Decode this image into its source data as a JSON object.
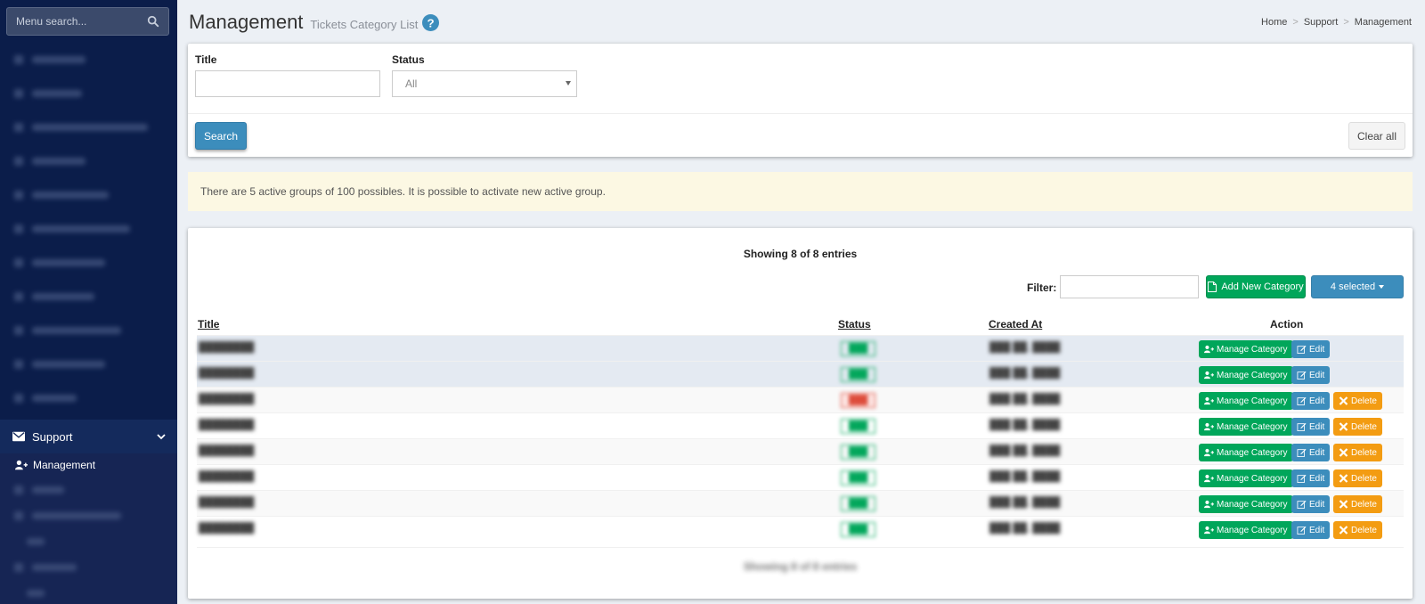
{
  "sidebar": {
    "search_placeholder": "Menu search...",
    "active_section": "Support",
    "active_item": "Management"
  },
  "header": {
    "title": "Management",
    "subtitle": "Tickets Category List",
    "breadcrumb": [
      "Home",
      "Support",
      "Management"
    ]
  },
  "filters": {
    "title_label": "Title",
    "title_value": "",
    "status_label": "Status",
    "status_value": "All",
    "search_button": "Search",
    "clear_button": "Clear all"
  },
  "alert": {
    "text": "There are 5 active groups of 100 possibles. It is possible to activate new active group."
  },
  "table": {
    "showing": "Showing 8 of 8 entries",
    "filter_label": "Filter:",
    "add_button": "Add New Category",
    "selected_button": "4 selected",
    "columns": [
      "Title",
      "Status",
      "Created At",
      "Action"
    ],
    "actions": {
      "manage": "Manage Category",
      "edit": "Edit",
      "delete": "Delete"
    },
    "rows": [
      {
        "selected": true,
        "status": "active",
        "deletable": false
      },
      {
        "selected": true,
        "status": "active",
        "deletable": false
      },
      {
        "selected": false,
        "status": "inactive",
        "deletable": true
      },
      {
        "selected": false,
        "status": "active",
        "deletable": true
      },
      {
        "selected": false,
        "status": "active",
        "deletable": true
      },
      {
        "selected": false,
        "status": "active",
        "deletable": true
      },
      {
        "selected": false,
        "status": "active",
        "deletable": true
      },
      {
        "selected": false,
        "status": "active",
        "deletable": true
      }
    ]
  },
  "colors": {
    "sidebar_bg": "#0b1d4a",
    "primary": "#3c8dbc",
    "success": "#00a65a",
    "warning": "#f39c12",
    "alert_bg": "#fcf8e3"
  }
}
